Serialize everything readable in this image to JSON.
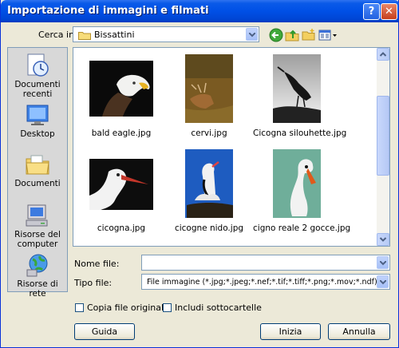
{
  "window": {
    "title": "Importazione di immagini e filmati",
    "help_glyph": "?",
    "close_glyph": "✕"
  },
  "look_in": {
    "label": "Cerca in:",
    "value": "Bissattini"
  },
  "places": [
    {
      "name": "recent",
      "label": "Documenti recenti"
    },
    {
      "name": "desktop",
      "label": "Desktop"
    },
    {
      "name": "documents",
      "label": "Documenti"
    },
    {
      "name": "computer",
      "label": "Risorse del computer"
    },
    {
      "name": "network",
      "label": "Risorse di rete"
    }
  ],
  "files": [
    {
      "name": "bald eagle.jpg"
    },
    {
      "name": "cervi.jpg"
    },
    {
      "name": "Cicogna silouhette.jpg"
    },
    {
      "name": "cicogna.jpg"
    },
    {
      "name": "cicogne nido.jpg"
    },
    {
      "name": "cigno reale 2 gocce.jpg"
    }
  ],
  "filename": {
    "label": "Nome file:",
    "value": ""
  },
  "filetype": {
    "label": "Tipo file:",
    "value": "File immagine (*.jpg;*.jpeg;*.nef;*.tif;*.tiff;*.png;*.mov;*.ndf)"
  },
  "options": {
    "copy_originals": "Copia file originali",
    "include_subfolders": "Includi sottocartelle"
  },
  "buttons": {
    "help": "Guida",
    "start": "Inizia",
    "cancel": "Annulla"
  },
  "colors": {
    "titlebar": "#0054e3",
    "dialog_bg": "#ece9d8",
    "border": "#7f9db9"
  }
}
